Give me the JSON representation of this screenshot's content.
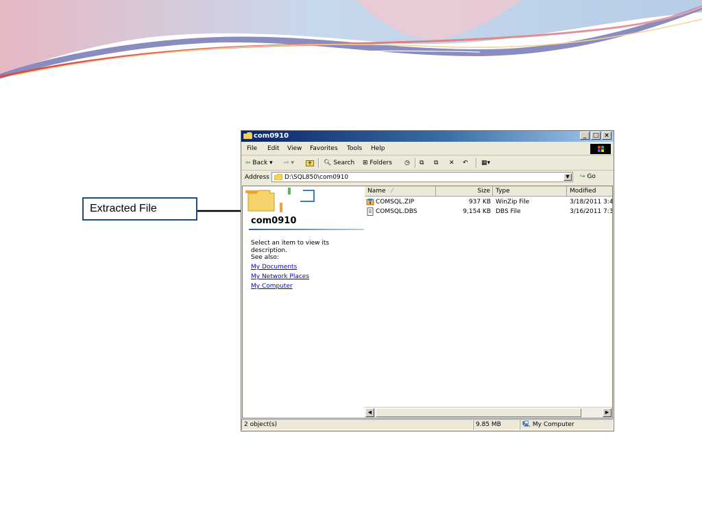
{
  "callout": {
    "label": "Extracted File"
  },
  "window": {
    "title": "com0910",
    "controls": {
      "minimize": "_",
      "maximize": "□",
      "close": "×"
    }
  },
  "menu": [
    "File",
    "Edit",
    "View",
    "Favorites",
    "Tools",
    "Help"
  ],
  "toolbar": {
    "back": "Back",
    "search": "Search",
    "folders": "Folders"
  },
  "address": {
    "label": "Address",
    "value": "D:\\SQL850\\com0910",
    "go": "Go"
  },
  "left_pane": {
    "folder_title": "com0910",
    "description": "Select an item to view its description.",
    "see_also": "See also:",
    "links": [
      "My Documents",
      "My Network Places",
      "My Computer"
    ]
  },
  "columns": {
    "name": "Name",
    "size": "Size",
    "type": "Type",
    "modified": "Modified"
  },
  "files": [
    {
      "name": "COMSQL.ZIP",
      "size": "937 KB",
      "type": "WinZip File",
      "modified": "3/18/2011 3:4",
      "icon": "winzip-icon"
    },
    {
      "name": "COMSQL.DBS",
      "size": "9,154 KB",
      "type": "DBS File",
      "modified": "3/16/2011 7:3",
      "icon": "document-icon"
    }
  ],
  "status": {
    "objects": "2 object(s)",
    "size": "9.85 MB",
    "location": "My Computer"
  },
  "colors": {
    "title_start": "#0a246a",
    "title_end": "#a6caf0",
    "chrome": "#ece9d8",
    "link": "#0000ee",
    "callout_border": "#1f4e79"
  }
}
